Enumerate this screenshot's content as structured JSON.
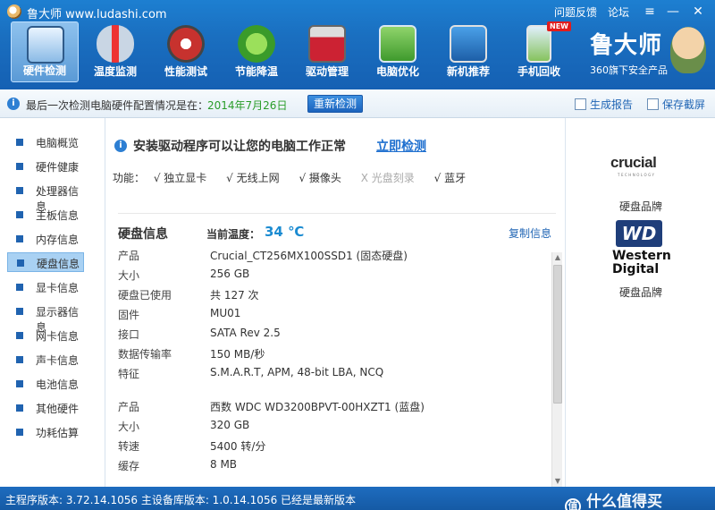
{
  "window": {
    "app_title": "鲁大师 www.ludashi.com",
    "link_feedback": "问题反馈",
    "link_forum": "论坛",
    "btn_menu": "≡",
    "btn_min": "—",
    "btn_close": "✕"
  },
  "toolbar": {
    "items": [
      {
        "label": "硬件检测",
        "icon": "monitor-magnifier-icon"
      },
      {
        "label": "温度监测",
        "icon": "thermometer-icon"
      },
      {
        "label": "性能测试",
        "icon": "speedometer-icon"
      },
      {
        "label": "节能降温",
        "icon": "clover-icon"
      },
      {
        "label": "驱动管理",
        "icon": "toolbox-icon"
      },
      {
        "label": "电脑优化",
        "icon": "optimize-screen-icon"
      },
      {
        "label": "新机推荐",
        "icon": "new-pc-icon"
      },
      {
        "label": "手机回收",
        "icon": "phone-recycle-icon"
      }
    ],
    "new_badge": "NEW",
    "active_index": 0
  },
  "brand": {
    "name": "鲁大师",
    "subtitle": "360旗下安全产品"
  },
  "infobar": {
    "text": "最后一次检测电脑硬件配置情况是在：",
    "date": "2014年7月26日",
    "redetect_btn": "重新检测",
    "generate_report": "生成报告",
    "save_screenshot": "保存截屏"
  },
  "sidebar": {
    "items": [
      {
        "label": "电脑概览"
      },
      {
        "label": "硬件健康"
      },
      {
        "label": "处理器信息"
      },
      {
        "label": "主板信息"
      },
      {
        "label": "内存信息"
      },
      {
        "label": "硬盘信息"
      },
      {
        "label": "显卡信息"
      },
      {
        "label": "显示器信息"
      },
      {
        "label": "网卡信息"
      },
      {
        "label": "声卡信息"
      },
      {
        "label": "电池信息"
      },
      {
        "label": "其他硬件"
      },
      {
        "label": "功耗估算"
      }
    ],
    "active_index": 5
  },
  "main": {
    "driver_message": "安装驱动程序可以让您的电脑工作正常",
    "driver_link": "立即检测",
    "func_label": "功能：",
    "functions": [
      {
        "text": "√ 独立显卡",
        "enabled": true
      },
      {
        "text": "√ 无线上网",
        "enabled": true
      },
      {
        "text": "√ 摄像头",
        "enabled": true
      },
      {
        "text": "X 光盘刻录",
        "enabled": false
      },
      {
        "text": "√ 蓝牙",
        "enabled": true
      }
    ],
    "hd_title": "硬盘信息",
    "temp_label": "当前温度：",
    "temp_value": "34 ℃",
    "copy_link": "复制信息",
    "disk1": [
      {
        "k": "产品",
        "v": "Crucial_CT256MX100SSD1 (固态硬盘)"
      },
      {
        "k": "大小",
        "v": "256 GB"
      },
      {
        "k": "硬盘已使用",
        "v": "共 127 次"
      },
      {
        "k": "固件",
        "v": "MU01"
      },
      {
        "k": "接口",
        "v": "SATA Rev 2.5"
      },
      {
        "k": "数据传输率",
        "v": "150 MB/秒"
      },
      {
        "k": "特征",
        "v": "S.M.A.R.T,  APM,  48-bit LBA,  NCQ"
      }
    ],
    "disk2": [
      {
        "k": "产品",
        "v": "西数 WDC WD3200BPVT-00HXZT1 (蓝盘)"
      },
      {
        "k": "大小",
        "v": "320 GB"
      },
      {
        "k": "转速",
        "v": "5400 转/分"
      },
      {
        "k": "缓存",
        "v": "8 MB"
      }
    ]
  },
  "right_panel": {
    "crucial_word": "crucial",
    "crucial_sub": "TECHNOLOGY",
    "caption1": "硬盘品牌",
    "wd_box": "WD",
    "wd_line1": "Western",
    "wd_line2": "Digital",
    "caption2": "硬盘品牌"
  },
  "statusbar": {
    "text": "主程序版本: 3.72.14.1056   主设备库版本: 1.0.14.1056   已经是最新版本",
    "watermark": "什么值得买",
    "watermark_glyph": "值"
  },
  "colors": {
    "accent_blue": "#1a6fc0",
    "temp_blue": "#1b8bd1",
    "date_green": "#2a9d2a",
    "link_blue": "#2166b5"
  }
}
